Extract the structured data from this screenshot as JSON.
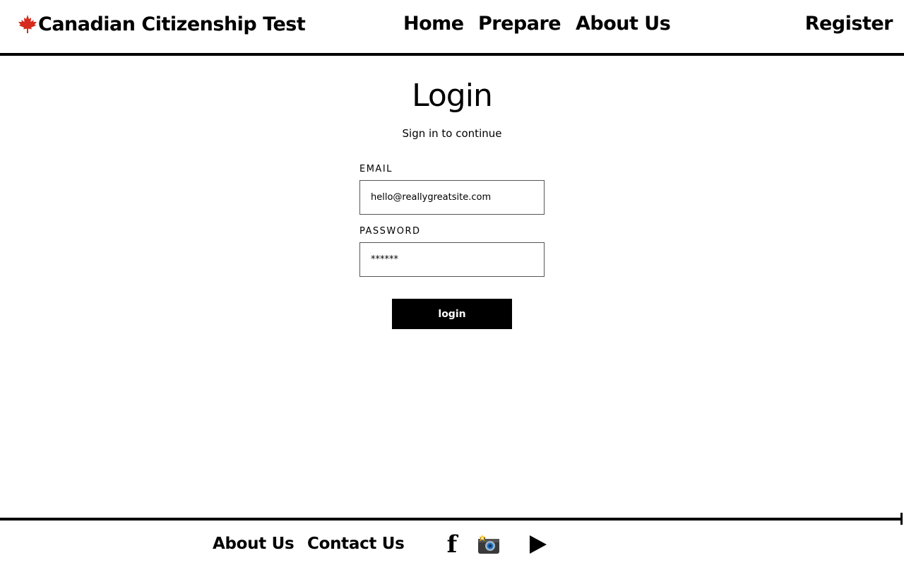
{
  "header": {
    "brand_title": "Canadian Citizenship Test",
    "brand_icon": "maple-leaf-icon",
    "nav": {
      "home": "Home",
      "prepare": "Prepare",
      "about": "About Us",
      "register": "Register"
    }
  },
  "login": {
    "title": "Login",
    "subtitle": "Sign in to continue",
    "email_label": "EMAIL",
    "email_value": "hello@reallygreatsite.com",
    "password_label": "PASSWORD",
    "password_value": "******",
    "button_label": "login"
  },
  "footer": {
    "about": "About Us",
    "contact": "Contact Us",
    "facebook_glyph": "f",
    "social_icons": [
      "facebook-icon",
      "instagram-camera-icon",
      "youtube-play-icon"
    ]
  },
  "colors": {
    "maple_red": "#d52b1e",
    "text": "#000000",
    "button_bg": "#000000",
    "button_text": "#ffffff"
  }
}
